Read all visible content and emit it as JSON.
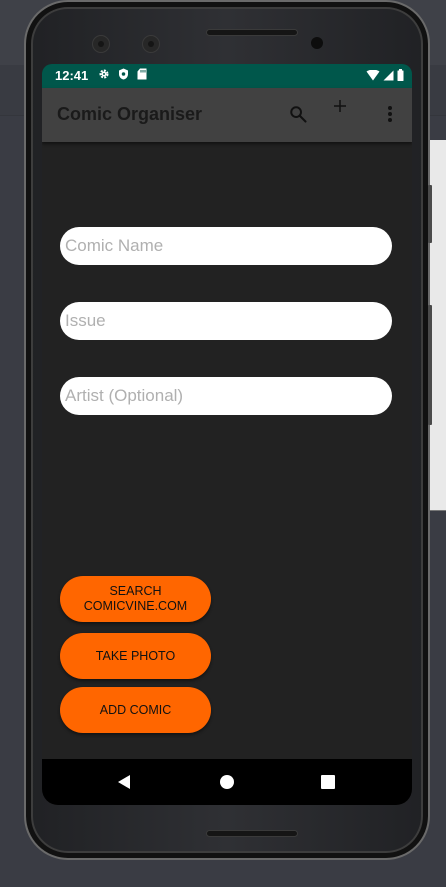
{
  "status_bar": {
    "time": "12:41",
    "icons_left": [
      "settings-icon",
      "shield-icon",
      "sd-card-icon"
    ],
    "icons_right": [
      "wifi-icon",
      "signal-icon",
      "battery-icon"
    ],
    "color": "#00574b"
  },
  "app_bar": {
    "title": "Comic Organiser",
    "actions": [
      "search-icon",
      "add-icon",
      "overflow-menu-icon"
    ],
    "color": "#414141"
  },
  "form": {
    "comic_name_placeholder": "Comic Name",
    "issue_placeholder": "Issue",
    "artist_placeholder": "Artist (Optional)"
  },
  "buttons": {
    "search_line1": "SEARCH",
    "search_line2": "COMICVINE.COM",
    "take_photo": "TAKE PHOTO",
    "add_comic": "ADD COMIC",
    "accent": "#ff6600"
  },
  "nav_bar": {
    "items": [
      "back-icon",
      "home-icon",
      "recents-icon"
    ]
  }
}
